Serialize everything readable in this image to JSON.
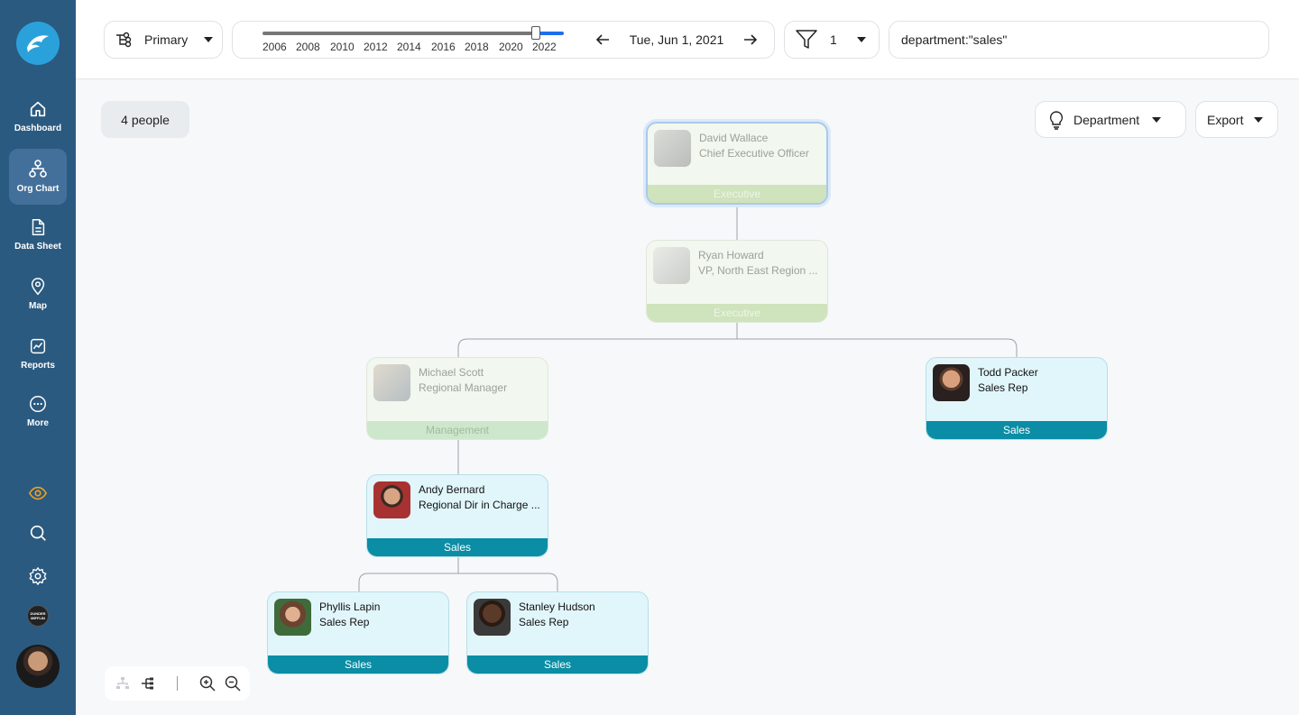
{
  "sidebar": {
    "items": [
      {
        "label": "Dashboard",
        "icon": "home-icon"
      },
      {
        "label": "Org Chart",
        "icon": "org-chart-icon"
      },
      {
        "label": "Data Sheet",
        "icon": "document-icon"
      },
      {
        "label": "Map",
        "icon": "map-pin-icon"
      },
      {
        "label": "Reports",
        "icon": "reports-icon"
      },
      {
        "label": "More",
        "icon": "more-icon"
      }
    ],
    "tiny_logo_text": "DUNDER MIFFLIN"
  },
  "topbar": {
    "primary_label": "Primary",
    "years": [
      "2006",
      "2008",
      "2010",
      "2012",
      "2014",
      "2016",
      "2018",
      "2020",
      "2022"
    ],
    "date": "Tue, Jun 1, 2021",
    "filter_count": "1",
    "search_value": "department:\"sales\""
  },
  "canvas": {
    "people_count": "4 people",
    "color_by_label": "Department",
    "export_label": "Export"
  },
  "people": [
    {
      "name": "David Wallace",
      "title": "Chief Executive Officer",
      "department": "Executive"
    },
    {
      "name": "Ryan Howard",
      "title": "VP, North East Region ...",
      "department": "Executive"
    },
    {
      "name": "Michael Scott",
      "title": "Regional Manager",
      "department": "Management"
    },
    {
      "name": "Todd Packer",
      "title": "Sales Rep",
      "department": "Sales"
    },
    {
      "name": "Andy Bernard",
      "title": "Regional Dir in Charge ...",
      "department": "Sales"
    },
    {
      "name": "Phyllis Lapin",
      "title": "Sales Rep",
      "department": "Sales"
    },
    {
      "name": "Stanley Hudson",
      "title": "Sales Rep",
      "department": "Sales"
    }
  ],
  "colors": {
    "sidebar": "#2b5a80",
    "sales": "#0a8da5",
    "executive": "#cfe3bc",
    "accent": "#1f6feb",
    "eye": "#f0a020"
  }
}
